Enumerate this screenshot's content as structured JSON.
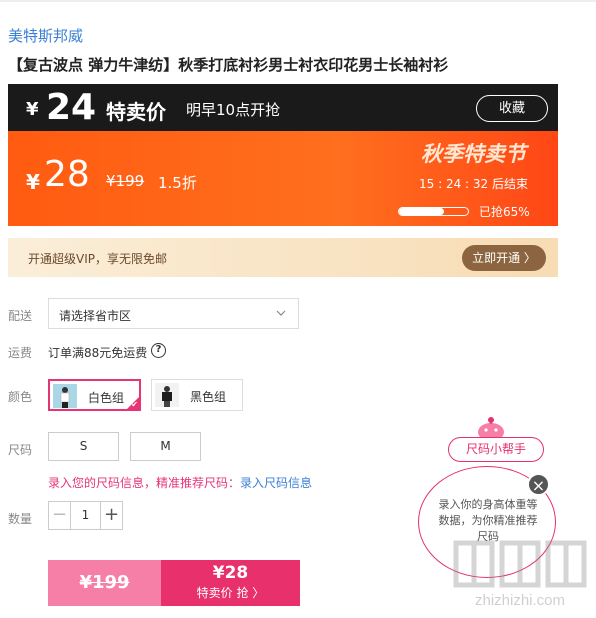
{
  "product": {
    "brand": "美特斯邦威",
    "title": "【复古波点 弹力牛津纺】秋季打底衬衫男士衬衣印花男士长袖衬衫"
  },
  "promo": {
    "currency": "¥",
    "sale_price": "24",
    "sale_label": "特卖价",
    "start_time": "明早10点开抢",
    "favorite_label": "收藏",
    "current_price": "28",
    "original_price": "¥199",
    "discount": "1.5折",
    "event_name": "秋季特卖节",
    "countdown": "15 : 24 : 32  后结束",
    "sold_progress": 0.65,
    "sold_text": "已抢65%"
  },
  "vip": {
    "text": "开通超级VIP，享无限免邮",
    "button": "立即开通 〉"
  },
  "delivery": {
    "label": "配送",
    "placeholder": "请选择省市区"
  },
  "shipping": {
    "label": "运费",
    "text": "订单满88元免运费",
    "help": "?"
  },
  "color": {
    "label": "颜色",
    "options": [
      "白色组",
      "黑色组"
    ]
  },
  "size": {
    "label": "尺码",
    "options": [
      "S",
      "M"
    ],
    "tip_prefix": "录入您的尺码信息，精准推荐尺码：",
    "tip_link": "录入尺码信息"
  },
  "quantity": {
    "label": "数量",
    "value": "1",
    "minus": "−",
    "plus": "+"
  },
  "buy": {
    "original": "¥199",
    "price": "¥28",
    "action": "特卖价 抢 〉"
  },
  "helper": {
    "pill": "尺码小帮手",
    "bubble": "录入你的身高体重等数据，为你精准推荐尺码",
    "close": "×"
  },
  "watermark": {
    "url": "zhizhizhi.com"
  },
  "colors": {
    "accent": "#e8306d",
    "link": "#3b7fd6",
    "promo_orange": "#ff5b11",
    "vip_brown": "#8c6540"
  }
}
